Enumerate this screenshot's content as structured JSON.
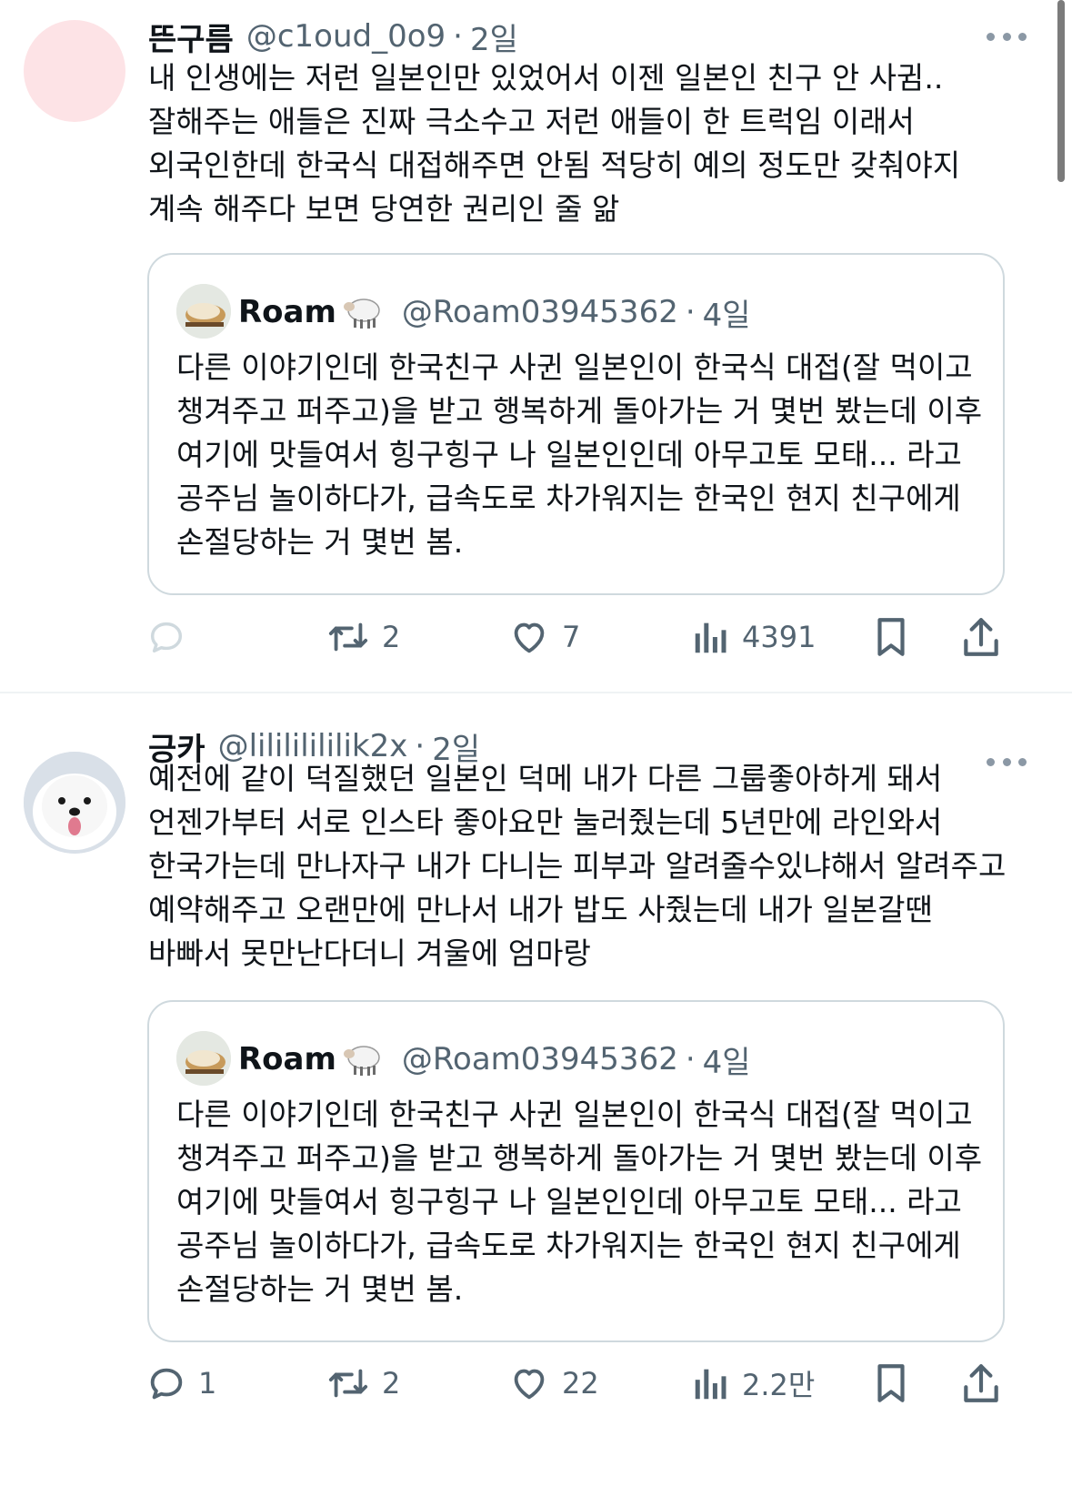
{
  "tweets": [
    {
      "name": "뜬구름",
      "handle": "@c1oud_0o9",
      "dot": "·",
      "time": "2일",
      "text": "내 인생에는 저런 일본인만 있었어서 이젠 일본인 친구 안 사귐.. 잘해주는 애들은 진짜 극소수고 저런 애들이 한 트럭임 이래서 외국인한데 한국식 대접해주면 안됨 적당히 예의 정도만 갖춰야지 계속 해주다 보면 당연한 권리인 줄 앎",
      "quote": {
        "name": "Roam",
        "handle": "@Roam03945362",
        "dot": "·",
        "time": "4일",
        "text": "다른 이야기인데 한국친구 사귄 일본인이 한국식 대접(잘 먹이고 챙겨주고 퍼주고)을 받고 행복하게 돌아가는 거 몇번 봤는데 이후 여기에 맛들여서 힝구힝구 나 일본인인데 아무고토 모태... 라고 공주님 놀이하다가, 급속도로 차가워지는 한국인 현지 친구에게 손절당하는 거 몇번 봄."
      },
      "actions": {
        "replies": "",
        "retweets": "2",
        "likes": "7",
        "views": "4391"
      }
    },
    {
      "name": "긍카",
      "handle": "@lilililililik2x",
      "dot": "·",
      "time": "2일",
      "text": "예전에 같이 덕질했던 일본인 덕메 내가 다른 그룹좋아하게 돼서 언젠가부터 서로 인스타 좋아요만 눌러줬는데 5년만에 라인와서 한국가는데 만나자구 내가 다니는 피부과 알려줄수있냐해서 알려주고 예약해주고 오랜만에 만나서 내가 밥도 사줬는데 내가 일본갈땐 바빠서 못만난다더니 겨울에 엄마랑",
      "quote": {
        "name": "Roam",
        "handle": "@Roam03945362",
        "dot": "·",
        "time": "4일",
        "text": "다른 이야기인데 한국친구 사귄 일본인이 한국식 대접(잘 먹이고 챙겨주고 퍼주고)을 받고 행복하게 돌아가는 거 몇번 봤는데 이후 여기에 맛들여서 힝구힝구 나 일본인인데 아무고토 모태... 라고 공주님 놀이하다가, 급속도로 차가워지는 한국인 현지 친구에게 손절당하는 거 몇번 봄."
      },
      "actions": {
        "replies": "1",
        "retweets": "2",
        "likes": "22",
        "views": "2.2만"
      }
    }
  ],
  "icons": {
    "reply": "reply-icon",
    "retweet": "retweet-icon",
    "like": "heart-icon",
    "views": "views-icon",
    "bookmark": "bookmark-icon",
    "share": "share-icon",
    "more": "more-icon",
    "sheep": "sheep-emoji-icon"
  },
  "colors": {
    "text": "#0f1419",
    "secondary": "#536471",
    "border": "#cfd9de",
    "divider": "#eff3f4"
  }
}
